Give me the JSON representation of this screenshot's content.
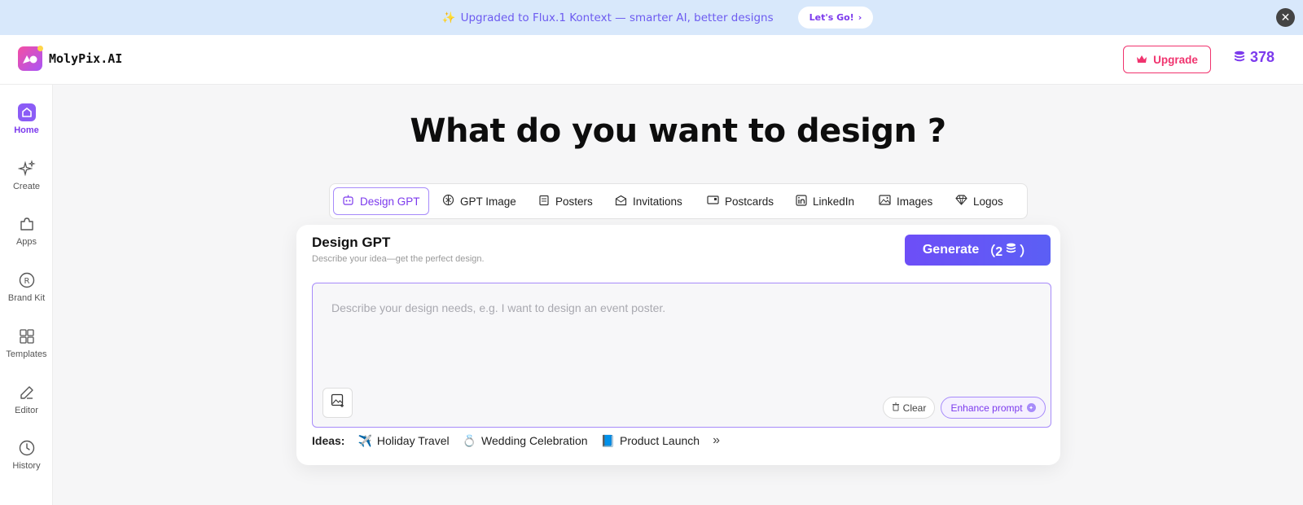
{
  "banner": {
    "emoji": "✨",
    "text": "Upgraded to Flux.1 Kontext — smarter AI, better designs",
    "cta_label": "Let's Go!",
    "cta_chevron": "›",
    "close_symbol": "✕"
  },
  "header": {
    "logo_text": "MolyPix.AI",
    "upgrade_label": "Upgrade",
    "credits": "378"
  },
  "sidebar": {
    "items": [
      {
        "label": "Home",
        "icon": "home-icon",
        "active": true
      },
      {
        "label": "Create",
        "icon": "sparkle-icon"
      },
      {
        "label": "Apps",
        "icon": "puzzle-icon"
      },
      {
        "label": "Brand Kit",
        "icon": "registered-icon"
      },
      {
        "label": "Templates",
        "icon": "grid-icon"
      },
      {
        "label": "Editor",
        "icon": "pen-icon"
      },
      {
        "label": "History",
        "icon": "clock-icon"
      }
    ]
  },
  "main": {
    "title": "What do you want to design ?",
    "tabs": [
      {
        "label": "Design GPT",
        "icon": "robot-icon",
        "active": true
      },
      {
        "label": "GPT Image",
        "icon": "openai-icon"
      },
      {
        "label": "Posters",
        "icon": "poster-icon"
      },
      {
        "label": "Invitations",
        "icon": "envelope-icon"
      },
      {
        "label": "Postcards",
        "icon": "postcard-icon"
      },
      {
        "label": "LinkedIn",
        "icon": "linkedin-icon"
      },
      {
        "label": "Images",
        "icon": "image-icon"
      },
      {
        "label": "Logos",
        "icon": "diamond-icon"
      }
    ],
    "card": {
      "title": "Design GPT",
      "subtitle": "Describe your idea—get the perfect design.",
      "generate_label": "Generate",
      "generate_cost": "（2",
      "generate_cost_close": "）",
      "prompt_placeholder": "Describe your design needs, e.g. I want to design an event poster.",
      "prompt_value": "",
      "clear_label": "Clear",
      "enhance_label": "Enhance prompt"
    },
    "ideas": {
      "label": "Ideas:",
      "items": [
        {
          "emoji": "✈️",
          "label": "Holiday Travel"
        },
        {
          "emoji": "💍",
          "label": "Wedding Celebration"
        },
        {
          "emoji": "📘",
          "label": "Product Launch"
        }
      ],
      "more_symbol": "»"
    }
  },
  "colors": {
    "accent": "#7c3aed",
    "brand_pink": "#f0336e",
    "banner_bg": "#d8e8fb"
  }
}
